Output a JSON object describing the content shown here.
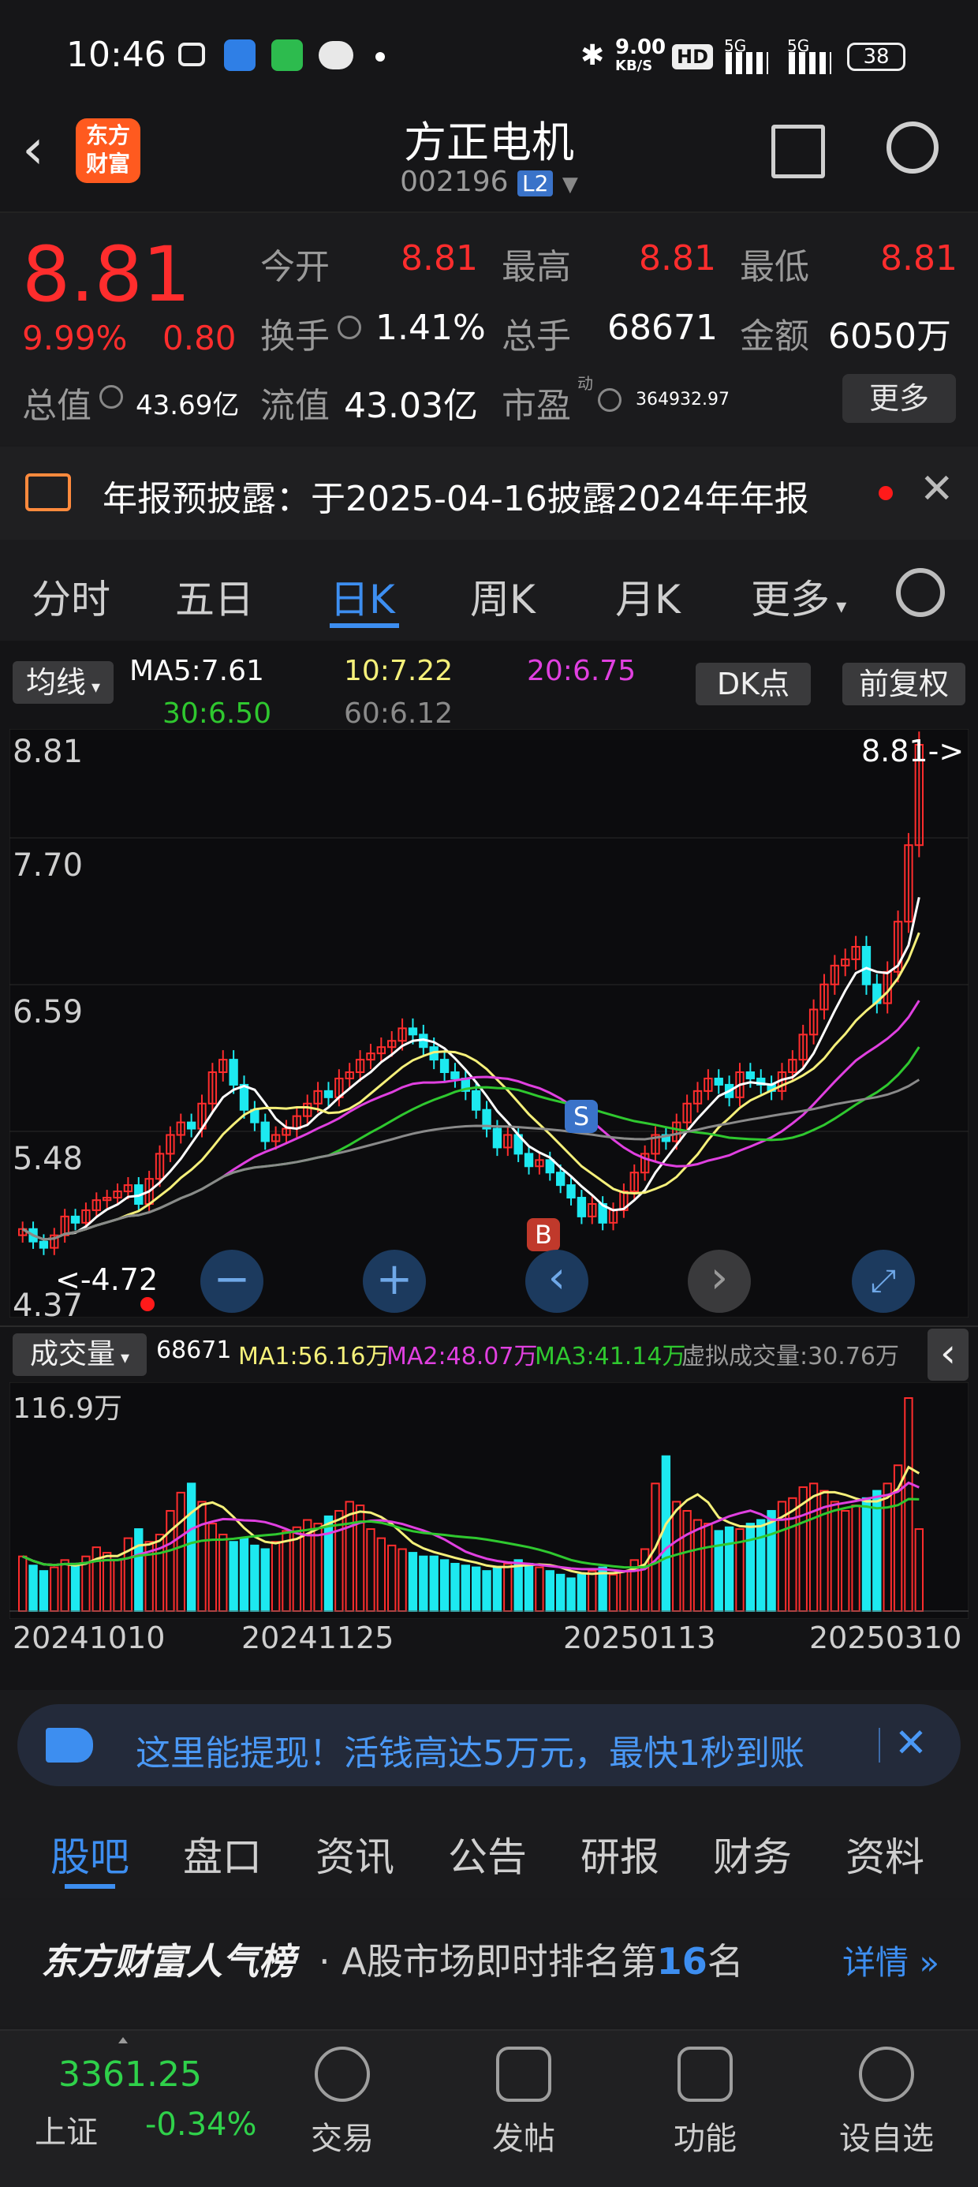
{
  "status_bar": {
    "time": "10:46",
    "net_speed": "9.00",
    "net_unit": "KB/S",
    "hd": "HD",
    "sig1": "5G",
    "sig2": "5G",
    "battery": "38"
  },
  "header": {
    "logo_top": "东方",
    "logo_bottom": "财富",
    "name": "方正电机",
    "code": "002196",
    "level": "L2"
  },
  "quote": {
    "price": "8.81",
    "pct": "9.99%",
    "chg": "0.80",
    "open_label": "今开",
    "open": "8.81",
    "high_label": "最高",
    "high": "8.81",
    "low_label": "最低",
    "low": "8.81",
    "turnover_label": "换手",
    "turnover": "1.41%",
    "volume_label": "总手",
    "volume": "68671",
    "amount_label": "金额",
    "amount": "6050万",
    "mktcap_label": "总值",
    "mktcap": "43.69亿",
    "float_label": "流值",
    "float": "43.03亿",
    "pe_label": "市盈",
    "pe_sup": "动",
    "pe": "364932.97",
    "more": "更多"
  },
  "notice": {
    "text": "年报预披露：于2025-04-16披露2024年年报"
  },
  "period_tabs": [
    "分时",
    "五日",
    "日K",
    "周K",
    "月K",
    "更多"
  ],
  "active_tab": 2,
  "ma_bar": {
    "selector": "均线",
    "ma5": "MA5:7.61",
    "ma10": "10:7.22",
    "ma20": "20:6.75",
    "ma30": "30:6.50",
    "ma60": "60:6.12",
    "dk": "DK点",
    "fq": "前复权"
  },
  "price_axis": {
    "labels": [
      "8.81",
      "7.70",
      "6.59",
      "5.48",
      "4.37"
    ],
    "current_marker": "8.81->",
    "low_marker": "<-4.72"
  },
  "markers": {
    "sell": "S",
    "buy": "B"
  },
  "volume_bar": {
    "selector": "成交量",
    "vol": "68671",
    "ma1": "MA1:56.16万",
    "ma2": "MA2:48.07万",
    "ma3": "MA3:41.14万",
    "virtual": "虚拟成交量:30.76万",
    "max_label": "116.9万"
  },
  "dates": [
    "20241010",
    "20241125",
    "20250113",
    "20250310"
  ],
  "ad": {
    "text": "这里能提现！活钱高达5万元，最快1秒到账"
  },
  "bottom_tabs": [
    "股吧",
    "盘口",
    "资讯",
    "公告",
    "研报",
    "财务",
    "资料"
  ],
  "popular": {
    "brand": "东方财富人气榜",
    "text": "· A股市场即时排名第",
    "rank": "16",
    "suffix": "名",
    "detail": "详情"
  },
  "index": {
    "value": "3361.25",
    "name": "上证",
    "change": "-0.34%"
  },
  "nav": [
    "交易",
    "发帖",
    "功能",
    "设自选"
  ],
  "colors": {
    "up": "#ff2d2d",
    "down": "#1de9f0",
    "ma5": "#ffffff",
    "ma10": "#f5f07a",
    "ma20": "#e040e0",
    "ma30": "#2fc82f",
    "ma60": "#8a8a8a",
    "accent": "#3d8ef0"
  },
  "chart_data": {
    "type": "candlestick",
    "dates": [
      "20241010",
      "20241125",
      "20250113",
      "20250310"
    ],
    "price_axis": [
      8.81,
      7.7,
      6.59,
      5.48,
      4.37
    ],
    "ylim": [
      4.37,
      8.81
    ],
    "close_series": [
      4.95,
      4.85,
      4.8,
      4.9,
      5.05,
      5.0,
      5.1,
      5.18,
      5.2,
      5.25,
      5.3,
      5.15,
      5.35,
      5.55,
      5.7,
      5.8,
      5.75,
      5.95,
      6.2,
      6.3,
      6.1,
      5.9,
      5.8,
      5.65,
      5.7,
      5.75,
      5.85,
      5.95,
      6.05,
      6.0,
      6.15,
      6.2,
      6.3,
      6.35,
      6.4,
      6.45,
      6.55,
      6.5,
      6.4,
      6.3,
      6.2,
      6.15,
      6.05,
      5.9,
      5.75,
      5.6,
      5.7,
      5.55,
      5.45,
      5.5,
      5.4,
      5.3,
      5.2,
      5.05,
      5.15,
      5.0,
      5.1,
      5.25,
      5.4,
      5.55,
      5.7,
      5.65,
      5.8,
      5.95,
      6.05,
      6.15,
      6.1,
      6.0,
      6.2,
      6.15,
      6.1,
      6.05,
      6.2,
      6.3,
      6.5,
      6.7,
      6.9,
      7.05,
      7.1,
      7.2,
      6.9,
      6.75,
      7.0,
      7.4,
      8.01,
      8.81
    ],
    "volume_series": [
      30,
      25,
      22,
      24,
      28,
      26,
      30,
      35,
      32,
      28,
      40,
      45,
      38,
      42,
      55,
      65,
      70,
      60,
      48,
      42,
      38,
      40,
      36,
      34,
      38,
      44,
      46,
      50,
      48,
      52,
      55,
      60,
      58,
      45,
      40,
      36,
      34,
      32,
      30,
      30,
      28,
      26,
      25,
      24,
      22,
      24,
      26,
      28,
      26,
      24,
      22,
      20,
      18,
      20,
      22,
      24,
      20,
      22,
      28,
      34,
      70,
      85,
      60,
      55,
      50,
      48,
      44,
      46,
      45,
      48,
      50,
      55,
      60,
      62,
      68,
      70,
      66,
      60,
      55,
      58,
      62,
      66,
      70,
      80,
      116.9,
      45
    ],
    "ma5": 7.61,
    "ma10": 7.22,
    "ma20": 6.75,
    "ma30": 6.5,
    "ma60": 6.12,
    "vol_ma1": "56.16万",
    "vol_ma2": "48.07万",
    "vol_ma3": "41.14万"
  }
}
